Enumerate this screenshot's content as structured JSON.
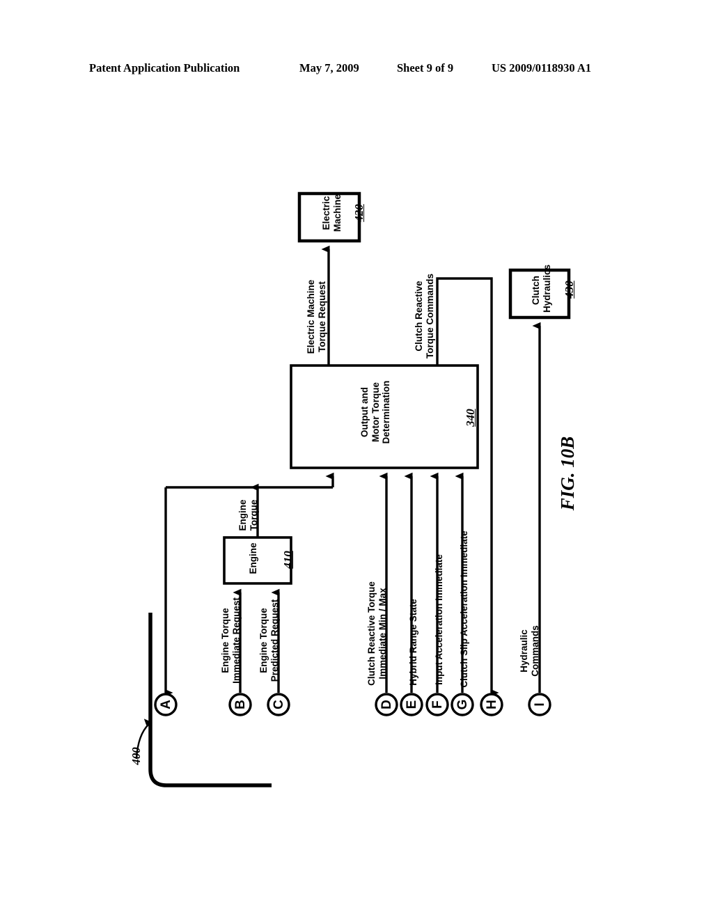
{
  "header": {
    "publication": "Patent Application Publication",
    "date": "May 7, 2009",
    "sheet": "Sheet 9 of 9",
    "patent_number": "US 2009/0118930 A1"
  },
  "figure": {
    "caption": "FIG. 10B",
    "system_ref": "400"
  },
  "blocks": [
    {
      "id": "electric-machine",
      "title": "Electric\nMachine",
      "title_lines": [
        "Electric",
        "Machine"
      ],
      "ref": "420"
    },
    {
      "id": "clutch-hydraulics",
      "title_lines": [
        "Clutch",
        "Hydraulics"
      ],
      "ref": "430"
    },
    {
      "id": "output-motor-torque",
      "title_lines": [
        "Output and",
        "Motor Torque",
        "Determination"
      ],
      "ref": "340"
    },
    {
      "id": "engine",
      "title_lines": [
        "Engine"
      ],
      "ref": "410"
    }
  ],
  "signals": [
    {
      "id": "electric-machine-torque-request",
      "lines": [
        "Electric Machine",
        "Torque Request"
      ]
    },
    {
      "id": "clutch-reactive-torque-commands",
      "lines": [
        "Clutch Reactive",
        "Torque Commands"
      ]
    },
    {
      "id": "engine-torque",
      "lines": [
        "Engine",
        "Torque"
      ]
    },
    {
      "id": "engine-torque-immediate-request",
      "lines": [
        "Engine Torque",
        "Immediate Request"
      ]
    },
    {
      "id": "engine-torque-predicted-request",
      "lines": [
        "Engine Torque",
        "Predicted Request"
      ]
    },
    {
      "id": "clutch-reactive-torque-immediate-minmax",
      "lines": [
        "Clutch Reactive Torque",
        "Immediate Min / Max"
      ]
    },
    {
      "id": "hybrid-range-state",
      "lines": [
        "Hybrid Range State"
      ]
    },
    {
      "id": "input-acceleration-immediate",
      "lines": [
        "Input Acceleration Immediate"
      ]
    },
    {
      "id": "clutch-slip-acceleration-immediate",
      "lines": [
        "Clutch Slip Acceleration Immediate"
      ]
    },
    {
      "id": "hydraulic-commands",
      "lines": [
        "Hydraulic",
        "Commands"
      ]
    }
  ],
  "connectors": [
    {
      "id": "A",
      "label": "A"
    },
    {
      "id": "B",
      "label": "B"
    },
    {
      "id": "C",
      "label": "C"
    },
    {
      "id": "D",
      "label": "D"
    },
    {
      "id": "E",
      "label": "E"
    },
    {
      "id": "F",
      "label": "F"
    },
    {
      "id": "G",
      "label": "G"
    },
    {
      "id": "H",
      "label": "H"
    },
    {
      "id": "I",
      "label": "I"
    }
  ],
  "colors": {
    "ink": "#000000",
    "paper": "#ffffff"
  }
}
